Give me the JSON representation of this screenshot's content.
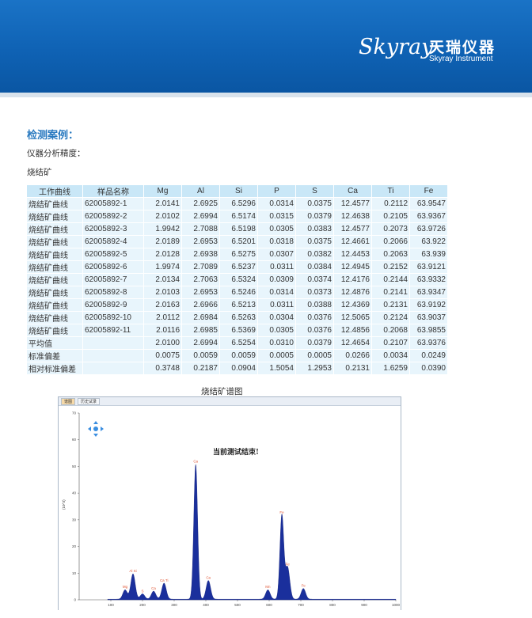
{
  "brand": {
    "script": "Skyray",
    "name_cn": "天瑞仪器",
    "name_en": "Skyray Instrument"
  },
  "section": {
    "title": "检测案例：",
    "subtitle": "仪器分析精度：",
    "material": "烧结矿"
  },
  "table": {
    "headers": [
      "工作曲线",
      "样品名称",
      "Mg",
      "Al",
      "Si",
      "P",
      "S",
      "Ca",
      "Ti",
      "Fe"
    ],
    "rows": [
      [
        "烧结矿曲线",
        "62005892-1",
        "2.0141",
        "2.6925",
        "6.5296",
        "0.0314",
        "0.0375",
        "12.4577",
        "0.2112",
        "63.9547"
      ],
      [
        "烧结矿曲线",
        "62005892-2",
        "2.0102",
        "2.6994",
        "6.5174",
        "0.0315",
        "0.0379",
        "12.4638",
        "0.2105",
        "63.9367"
      ],
      [
        "烧结矿曲线",
        "62005892-3",
        "1.9942",
        "2.7088",
        "6.5198",
        "0.0305",
        "0.0383",
        "12.4577",
        "0.2073",
        "63.9726"
      ],
      [
        "烧结矿曲线",
        "62005892-4",
        "2.0189",
        "2.6953",
        "6.5201",
        "0.0318",
        "0.0375",
        "12.4661",
        "0.2066",
        "63.922"
      ],
      [
        "烧结矿曲线",
        "62005892-5",
        "2.0128",
        "2.6938",
        "6.5275",
        "0.0307",
        "0.0382",
        "12.4453",
        "0.2063",
        "63.939"
      ],
      [
        "烧结矿曲线",
        "62005892-6",
        "1.9974",
        "2.7089",
        "6.5237",
        "0.0311",
        "0.0384",
        "12.4945",
        "0.2152",
        "63.9121"
      ],
      [
        "烧结矿曲线",
        "62005892-7",
        "2.0134",
        "2.7063",
        "6.5324",
        "0.0309",
        "0.0374",
        "12.4176",
        "0.2144",
        "63.9332"
      ],
      [
        "烧结矿曲线",
        "62005892-8",
        "2.0103",
        "2.6953",
        "6.5246",
        "0.0314",
        "0.0373",
        "12.4876",
        "0.2141",
        "63.9347"
      ],
      [
        "烧结矿曲线",
        "62005892-9",
        "2.0163",
        "2.6966",
        "6.5213",
        "0.0311",
        "0.0388",
        "12.4369",
        "0.2131",
        "63.9192"
      ],
      [
        "烧结矿曲线",
        "62005892-10",
        "2.0112",
        "2.6984",
        "6.5263",
        "0.0304",
        "0.0376",
        "12.5065",
        "0.2124",
        "63.9037"
      ],
      [
        "烧结矿曲线",
        "62005892-11",
        "2.0116",
        "2.6985",
        "6.5369",
        "0.0305",
        "0.0376",
        "12.4856",
        "0.2068",
        "63.9855"
      ]
    ],
    "stats": [
      [
        "平均值",
        "",
        "2.0100",
        "2.6994",
        "6.5254",
        "0.0310",
        "0.0379",
        "12.4654",
        "0.2107",
        "63.9376"
      ],
      [
        "标准偏差",
        "",
        "0.0075",
        "0.0059",
        "0.0059",
        "0.0005",
        "0.0005",
        "0.0266",
        "0.0034",
        "0.0249"
      ],
      [
        "相对标准偏差",
        "",
        "0.3748",
        "0.2187",
        "0.0904",
        "1.5054",
        "1.2953",
        "0.2131",
        "1.6259",
        "0.0390"
      ]
    ]
  },
  "spectrum": {
    "title": "烧结矿谱图",
    "tabs": [
      "谱图",
      "历史试录"
    ],
    "status_text": "当前测试结束!",
    "ylabel": "(10^3)",
    "accent_color": "#1a2f9c",
    "icon": "pan-arrows-icon",
    "chart_data": {
      "type": "area",
      "xlim": [
        0,
        1000
      ],
      "ylim": [
        0,
        70
      ],
      "xticks": [
        "100",
        "200",
        "300",
        "400",
        "500",
        "600",
        "700",
        "800",
        "900",
        "1000"
      ],
      "yticks": [
        "0",
        "10",
        "20",
        "30",
        "40",
        "50",
        "60",
        "70"
      ],
      "peaks": [
        {
          "x": 145,
          "y": 3.5,
          "label": "Mg"
        },
        {
          "x": 170,
          "y": 9.5,
          "label": "Al Si"
        },
        {
          "x": 200,
          "y": 2,
          "label": "S"
        },
        {
          "x": 235,
          "y": 3,
          "label": "Ca"
        },
        {
          "x": 268,
          "y": 6,
          "label": "Ca Ti"
        },
        {
          "x": 368,
          "y": 50.5,
          "label": "Ca"
        },
        {
          "x": 408,
          "y": 7,
          "label": "Ca"
        },
        {
          "x": 596,
          "y": 3.5,
          "label": "Mn"
        },
        {
          "x": 640,
          "y": 31.5,
          "label": "Fe"
        },
        {
          "x": 658,
          "y": 12,
          "label": "Fe"
        },
        {
          "x": 708,
          "y": 4,
          "label": "Fe"
        }
      ]
    }
  }
}
